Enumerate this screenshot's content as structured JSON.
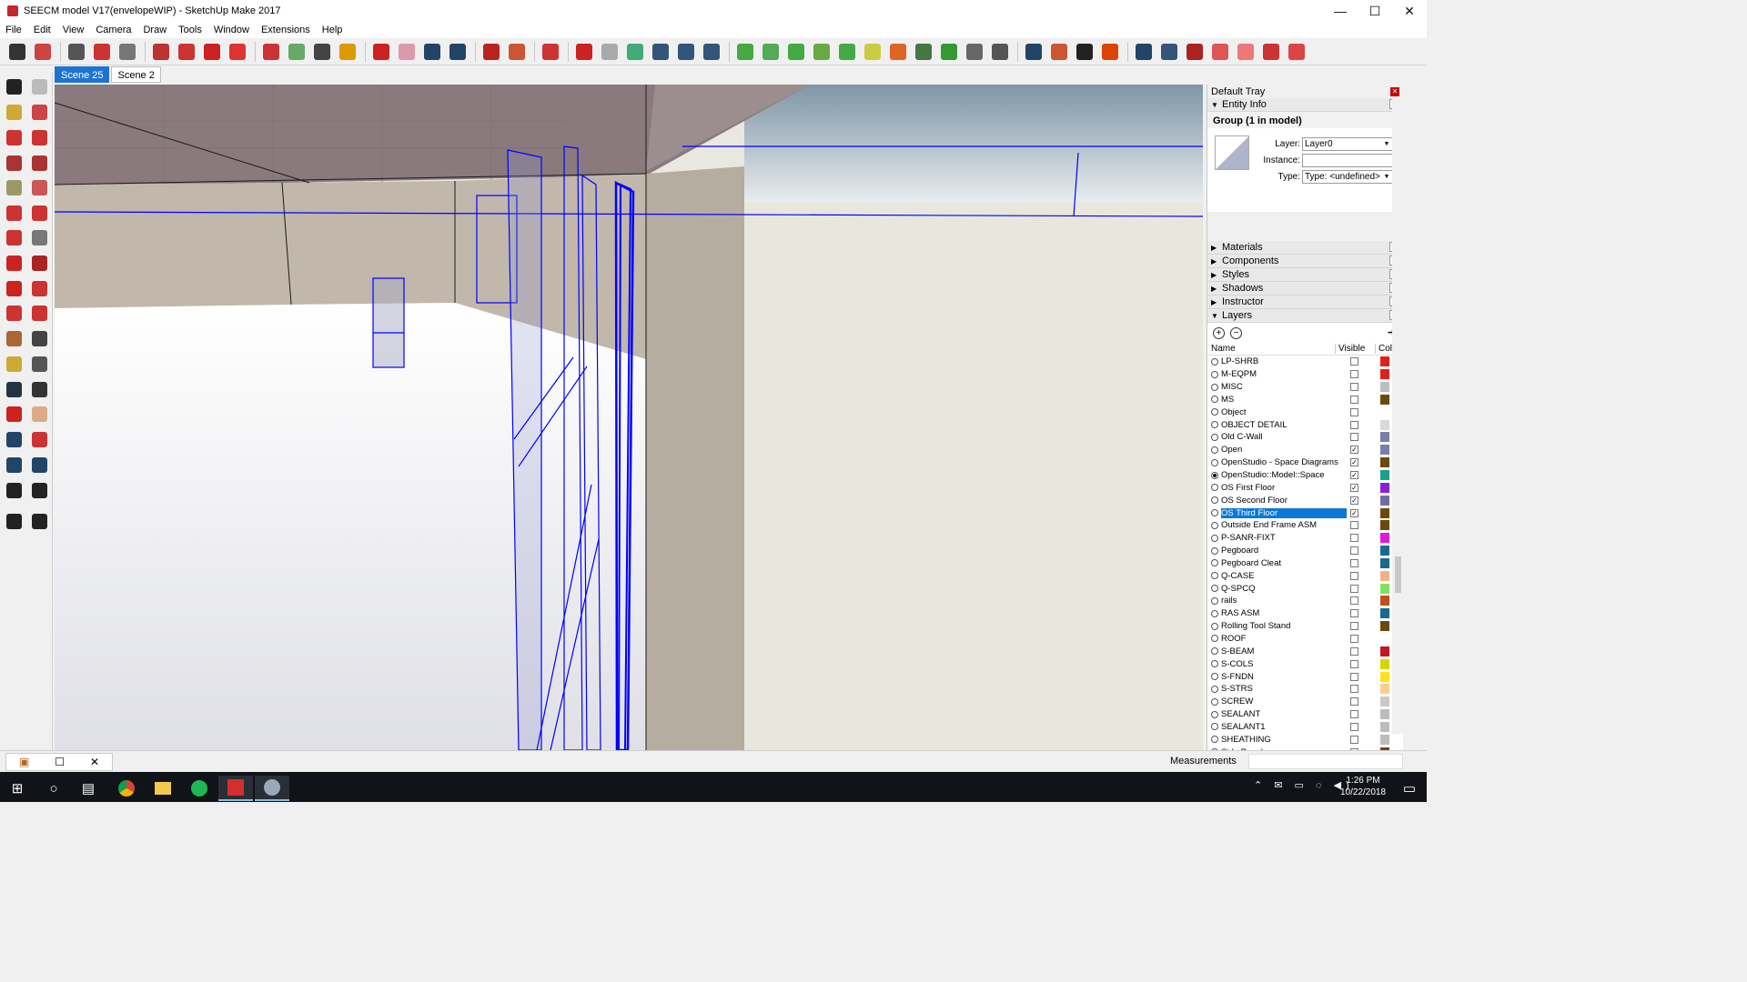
{
  "window": {
    "title": "SEECM model V17(envelopeWIP) - SketchUp Make 2017",
    "controls": [
      "—",
      "☐",
      "✕"
    ]
  },
  "menu": [
    "File",
    "Edit",
    "View",
    "Camera",
    "Draw",
    "Tools",
    "Window",
    "Extensions",
    "Help"
  ],
  "toolbar_icons": [
    "select-icon",
    "eraser-icon",
    "line-icon",
    "arc-icon",
    "rectangle-icon",
    "push-pull-icon",
    "follow-me-icon",
    "move-icon",
    "rotate-icon",
    "scale-icon",
    "tape-measure-icon",
    "text-icon",
    "paint-bucket-icon",
    "orbit-icon",
    "pan-icon",
    "zoom-icon",
    "zoom-extents-icon",
    "warehouse-icon",
    "extension-warehouse-icon",
    "layout-icon",
    "ruby-icon",
    "new-space-icon",
    "import-icon",
    "save-idf-icon",
    "idf-icon",
    "osm-icon",
    "space-icon",
    "thermal-zone-icon",
    "surface-icon",
    "subsurface-icon",
    "shading-icon",
    "light-icon",
    "people-icon",
    "equipment-icon",
    "construction-icon",
    "schedule-icon",
    "grid-icon",
    "inspector-icon",
    "filter-icon",
    "cursor-info-icon",
    "warning-icon",
    "render-mode-icon",
    "render-mode2-icon",
    "color-by-icon",
    "color-by2-icon",
    "color-by3-icon",
    "color-by4-icon",
    "color-by5-icon"
  ],
  "left_tools": [
    "select-icon",
    "component-icon",
    "paint-icon",
    "eraser-icon",
    "line-icon",
    "freehand-icon",
    "rectangle-icon",
    "rotated-rect-icon",
    "circle-icon",
    "polygon-icon",
    "arc-icon",
    "two-point-arc-icon",
    "three-point-arc-icon",
    "pie-icon",
    "move-icon",
    "push-pull-icon",
    "rotate-icon",
    "follow-me-icon",
    "scale-icon",
    "offset-icon",
    "tape-icon",
    "dimension-icon",
    "protractor-icon",
    "text-icon",
    "axes-icon",
    "3d-text-icon",
    "orbit-icon",
    "pan-icon",
    "zoom-icon",
    "zoom-window-icon",
    "zoom-extents-icon",
    "previous-icon",
    "position-camera-icon",
    "look-around-icon",
    "walk-icon",
    "section-plane-icon"
  ],
  "scenes": [
    "Scene 25",
    "Scene 2"
  ],
  "tray": {
    "title": "Default Tray",
    "entity_info": {
      "header": "Entity Info",
      "group_title": "Group (1 in model)",
      "layer_label": "Layer:",
      "layer_value": "Layer0",
      "instance_label": "Instance:",
      "instance_value": "",
      "type_label": "Type:",
      "type_value": "Type: <undefined>"
    },
    "panels": [
      "Materials",
      "Components",
      "Styles",
      "Shadows",
      "Instructor"
    ],
    "layers_header": "Layers",
    "col_name": "Name",
    "col_visible": "Visible",
    "col_color": "Colo",
    "layers": [
      {
        "name": "LP-SHRB",
        "visible": false,
        "color": "#e0201e"
      },
      {
        "name": "M-EQPM",
        "visible": false,
        "color": "#e0201e"
      },
      {
        "name": "MISC",
        "visible": false,
        "color": "#bdbdbd"
      },
      {
        "name": "MS",
        "visible": false,
        "color": "#6b4a0e"
      },
      {
        "name": "Object",
        "visible": false,
        "color": "#ffffff"
      },
      {
        "name": "OBJECT DETAIL",
        "visible": false,
        "color": "#d9d9d9"
      },
      {
        "name": "Old C-Wall",
        "visible": false,
        "color": "#7a7fa8"
      },
      {
        "name": "Open",
        "visible": true,
        "color": "#7a7fa8"
      },
      {
        "name": "OpenStudio - Space Diagrams",
        "visible": true,
        "color": "#6b4a0e"
      },
      {
        "name": "OpenStudio::Model::Space",
        "visible": true,
        "color": "#17a388",
        "active": true
      },
      {
        "name": "OS First Floor",
        "visible": true,
        "color": "#8a1fd6"
      },
      {
        "name": "OS Second Floor",
        "visible": true,
        "color": "#6f6fa6"
      },
      {
        "name": "OS Third Floor",
        "visible": true,
        "color": "#6b4a0e",
        "selected": true
      },
      {
        "name": "Outside End Frame ASM",
        "visible": false,
        "color": "#6b4a0e"
      },
      {
        "name": "P-SANR-FIXT",
        "visible": false,
        "color": "#e41ad9"
      },
      {
        "name": "Pegboard",
        "visible": false,
        "color": "#1b6a8f"
      },
      {
        "name": "Pegboard Cleat",
        "visible": false,
        "color": "#1b6a8f"
      },
      {
        "name": "Q-CASE",
        "visible": false,
        "color": "#f4b183"
      },
      {
        "name": "Q-SPCQ",
        "visible": false,
        "color": "#7fe35d"
      },
      {
        "name": "rails",
        "visible": false,
        "color": "#c0511c"
      },
      {
        "name": "RAS ASM",
        "visible": false,
        "color": "#1b6a8f"
      },
      {
        "name": "Rolling Tool Stand",
        "visible": false,
        "color": "#6b4a0e"
      },
      {
        "name": "ROOF",
        "visible": false,
        "color": "#ffffff"
      },
      {
        "name": "S-BEAM",
        "visible": false,
        "color": "#c4161c"
      },
      {
        "name": "S-COLS",
        "visible": false,
        "color": "#d4d700"
      },
      {
        "name": "S-FNDN",
        "visible": false,
        "color": "#ffe21c"
      },
      {
        "name": "S-STRS",
        "visible": false,
        "color": "#f8cf8c"
      },
      {
        "name": "SCREW",
        "visible": false,
        "color": "#c9c9c9"
      },
      {
        "name": "SEALANT",
        "visible": false,
        "color": "#bcbcbc"
      },
      {
        "name": "SEALANT1",
        "visible": false,
        "color": "#bcbcbc"
      },
      {
        "name": "SHEATHING",
        "visible": false,
        "color": "#bcbcbc"
      },
      {
        "name": "Side Panel",
        "visible": false,
        "color": "#6b4a0e"
      }
    ]
  },
  "status": {
    "measurements_label": "Measurements"
  },
  "taskbar": {
    "time": "1:26 PM",
    "date": "10/22/2018",
    "apps": [
      "windows-start-icon",
      "cortana-icon",
      "task-view-icon",
      "chrome-icon",
      "file-explorer-icon",
      "spotify-icon",
      "sketchup-icon",
      "openstudio-icon"
    ]
  }
}
